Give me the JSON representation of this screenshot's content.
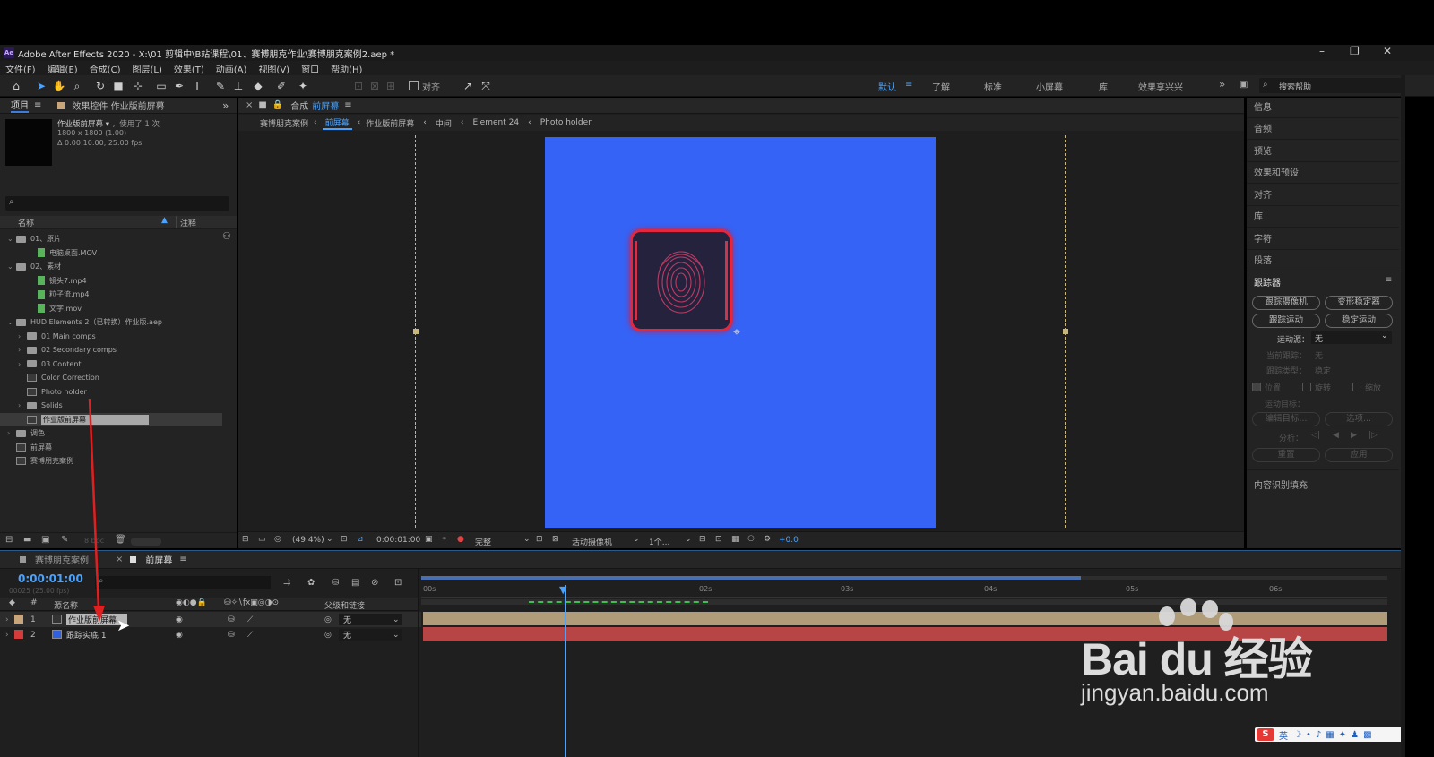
{
  "window": {
    "title": "Adobe After Effects 2020 - X:\\01 剪辑中\\B站课程\\01、赛博朋克作业\\赛博朋克案例2.aep *",
    "logo": "Ae"
  },
  "menu": [
    "文件(F)",
    "编辑(E)",
    "合成(C)",
    "图层(L)",
    "效果(T)",
    "动画(A)",
    "视图(V)",
    "窗口",
    "帮助(H)"
  ],
  "toolbar": {
    "snap_label": "对齐",
    "workspaces": [
      "默认",
      "了解",
      "标准",
      "小屏幕",
      "库",
      "效果享兴兴"
    ],
    "search_placeholder": "搜索帮助"
  },
  "project": {
    "tab_label": "项目",
    "effects_tab": "效果控件 作业版前屏幕",
    "item_name": "作业版前屏幕",
    "usage": "，使用了 1 次",
    "size": "1800 x 1800 (1.00)",
    "duration": "Δ 0:00:10:00, 25.00 fps",
    "col_name": "名称",
    "col_comment": "注释",
    "tree": [
      {
        "label": "01、原片",
        "type": "folder",
        "level": 0,
        "chev": "⌄"
      },
      {
        "label": "电脑桌面.MOV",
        "type": "file",
        "level": 2
      },
      {
        "label": "02、素材",
        "type": "folder",
        "level": 0,
        "chev": "⌄"
      },
      {
        "label": "镜头7.mp4",
        "type": "file",
        "level": 2
      },
      {
        "label": "粒子流.mp4",
        "type": "file",
        "level": 2
      },
      {
        "label": "文字.mov",
        "type": "file",
        "level": 2
      },
      {
        "label": "HUD Elements 2（已转换）作业版.aep",
        "type": "folder",
        "level": 0,
        "chev": "⌄"
      },
      {
        "label": "01 Main comps",
        "type": "folder",
        "level": 1,
        "chev": "›"
      },
      {
        "label": "02 Secondary comps",
        "type": "folder",
        "level": 1,
        "chev": "›"
      },
      {
        "label": "03 Content",
        "type": "folder",
        "level": 1,
        "chev": "›"
      },
      {
        "label": "Color Correction",
        "type": "comp",
        "level": 1
      },
      {
        "label": "Photo holder",
        "type": "comp",
        "level": 1
      },
      {
        "label": "Solids",
        "type": "folder",
        "level": 1,
        "chev": "›"
      },
      {
        "label": "作业版前屏幕",
        "type": "comp",
        "level": 1,
        "selected": true
      },
      {
        "label": "调色",
        "type": "folder",
        "level": 0,
        "chev": "›"
      },
      {
        "label": "前屏幕",
        "type": "comp",
        "level": 0
      },
      {
        "label": "赛博朋克案例",
        "type": "comp",
        "level": 0
      }
    ],
    "bpc": "8 bpc"
  },
  "composition": {
    "tab_prefix": "合成",
    "tab_name": "前屏幕",
    "breadcrumbs": [
      "赛博朋克案例",
      "前屏幕",
      "作业版前屏幕",
      "中间",
      "Element 24",
      "Photo holder"
    ],
    "zoom": "(49.4%)",
    "timecode": "0:00:01:00",
    "quality": "完整",
    "camera": "活动摄像机",
    "views": "1个...",
    "exposure": "+0.0",
    "bg_color": "#3563f5"
  },
  "right_panel": {
    "items": [
      "信息",
      "音频",
      "预览",
      "效果和预设",
      "对齐",
      "库",
      "字符",
      "段落"
    ],
    "tracker_title": "跟踪器",
    "buttons": [
      "跟踪摄像机",
      "变形稳定器",
      "跟踪运动",
      "稳定运动"
    ],
    "source_label": "运动源：",
    "source_value": "无",
    "current_track_label": "当前跟踪：",
    "current_track_value": "无",
    "track_type_label": "跟踪类型：",
    "track_type_value": "稳定",
    "checks": [
      "位置",
      "旋转",
      "缩放"
    ],
    "motion_target": "运动目标：",
    "edit_target": "编辑目标...",
    "options": "选项...",
    "analyze": "分析：",
    "reset": "重置",
    "apply": "应用",
    "content_fill": "内容识别填充"
  },
  "timeline": {
    "tabs": [
      "赛博朋克案例",
      "前屏幕"
    ],
    "timecode": "0:00:01:00",
    "frame_info": "00025 (25.00 fps)",
    "col_source": "源名称",
    "col_parent": "父级和链接",
    "ruler": [
      "00s",
      "02s",
      "03s",
      "04s",
      "05s",
      "06s"
    ],
    "layers": [
      {
        "num": "1",
        "name": "作业版前屏幕",
        "color": "#c8a57a",
        "parent": "无",
        "selected": true
      },
      {
        "num": "2",
        "name": "跟踪实底 1",
        "color": "#d43c3c",
        "parent": "无"
      }
    ]
  },
  "watermark": {
    "brand_text": "Bai du 经验",
    "url": "jingyan.baidu.com"
  },
  "taskbar": {
    "ime": "英"
  }
}
